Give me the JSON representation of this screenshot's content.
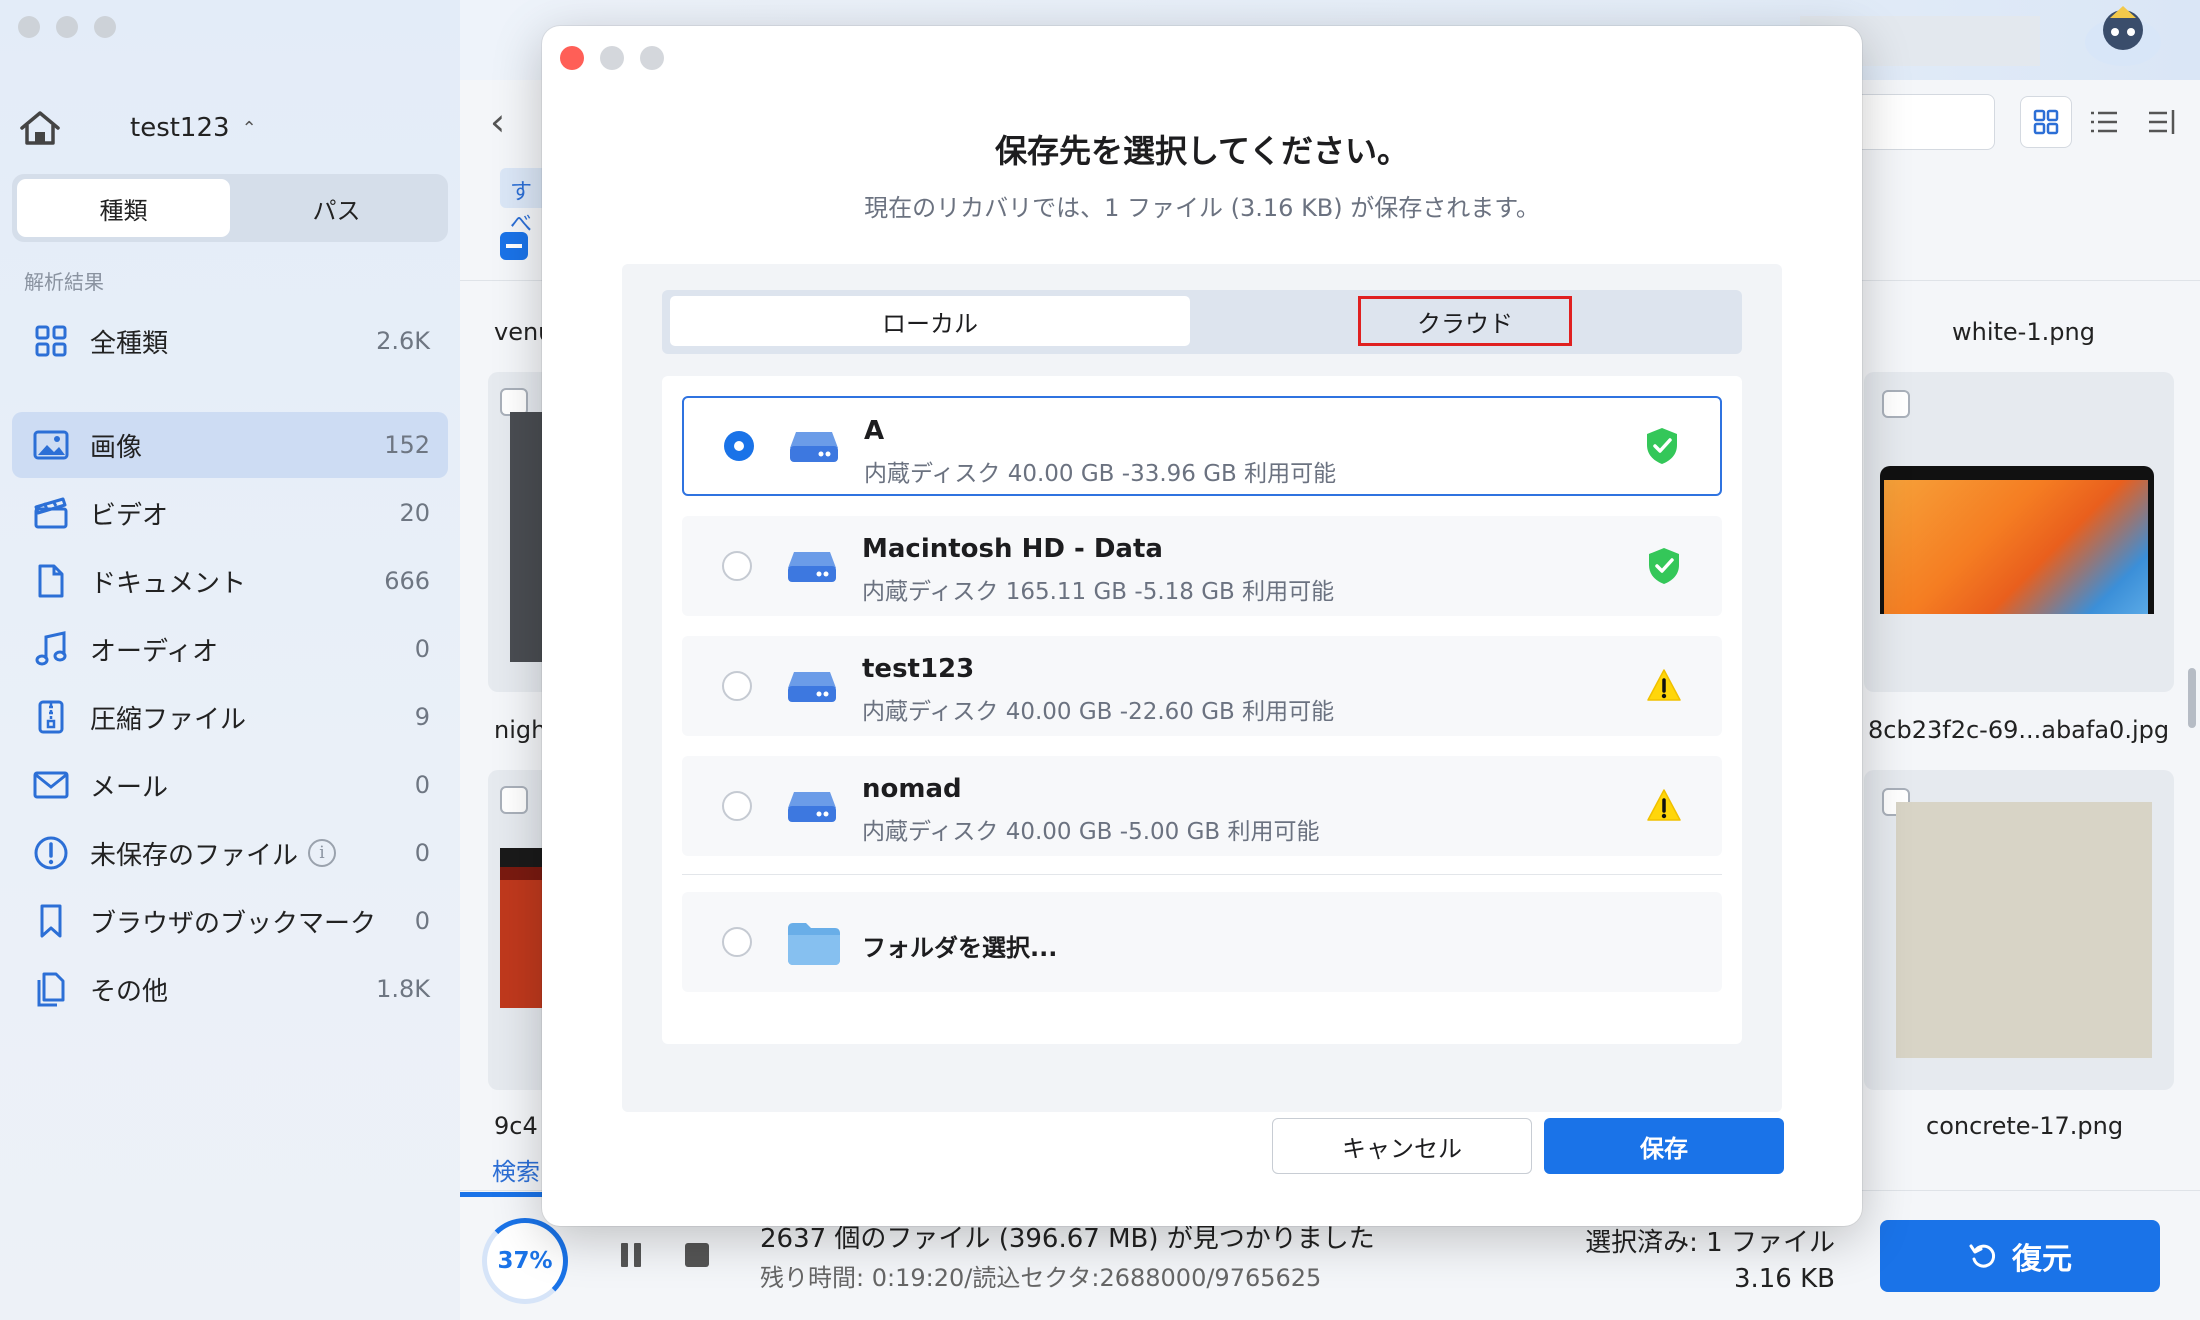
{
  "sidebar": {
    "drive_name": "test123",
    "tabs": [
      "種類",
      "パス"
    ],
    "section_label": "解析結果",
    "items": [
      {
        "label": "全種類",
        "count": "2.6K"
      },
      {
        "label": "画像",
        "count": "152"
      },
      {
        "label": "ビデオ",
        "count": "20"
      },
      {
        "label": "ドキュメント",
        "count": "666"
      },
      {
        "label": "オーディオ",
        "count": "0"
      },
      {
        "label": "圧縮ファイル",
        "count": "9"
      },
      {
        "label": "メール",
        "count": "0"
      },
      {
        "label": "未保存のファイル",
        "count": "0"
      },
      {
        "label": "ブラウザのブックマーク",
        "count": "0"
      },
      {
        "label": "その他",
        "count": "1.8K"
      }
    ]
  },
  "main": {
    "filter_tab": "すべ",
    "thumbs": {
      "left_top": "venu",
      "left_mid": "nigh",
      "left_bottom": "9c4",
      "right_top": "white-1.png",
      "right_mid": "8cb23f2c-69...abafa0.jpg",
      "right_bottom": "concrete-17.png"
    },
    "search_tab": "検索",
    "progress_pct": "37%",
    "found_text": "2637 個のファイル (396.67 MB) が見つかりました",
    "remaining_text": "残り時間: 0:19:20/読込セクタ:2688000/9765625",
    "selected_text": "選択済み: 1 ファイル",
    "selected_size": "3.16 KB",
    "recover_label": "復元"
  },
  "modal": {
    "title": "保存先を選択してください。",
    "subtitle": "現在のリカバリでは、1 ファイル (3.16 KB) が保存されます。",
    "tab_local": "ローカル",
    "tab_cloud": "クラウド",
    "drives": [
      {
        "name": "A",
        "desc": "内蔵ディスク 40.00 GB -33.96 GB 利用可能",
        "status": "ok",
        "selected": true
      },
      {
        "name": "Macintosh HD - Data",
        "desc": "内蔵ディスク 165.11 GB -5.18 GB 利用可能",
        "status": "ok",
        "selected": false
      },
      {
        "name": "test123",
        "desc": "内蔵ディスク 40.00 GB -22.60 GB 利用可能",
        "status": "warning",
        "selected": false
      },
      {
        "name": "nomad",
        "desc": "内蔵ディスク 40.00 GB -5.00 GB 利用可能",
        "status": "warning",
        "selected": false
      }
    ],
    "folder_label": "フォルダを選択...",
    "cancel_label": "キャンセル",
    "save_label": "保存"
  },
  "colors": {
    "accent": "#1a73e8",
    "ok_green": "#34c759",
    "warning_yellow": "#ffd60a",
    "highlight_red": "#e02020"
  }
}
